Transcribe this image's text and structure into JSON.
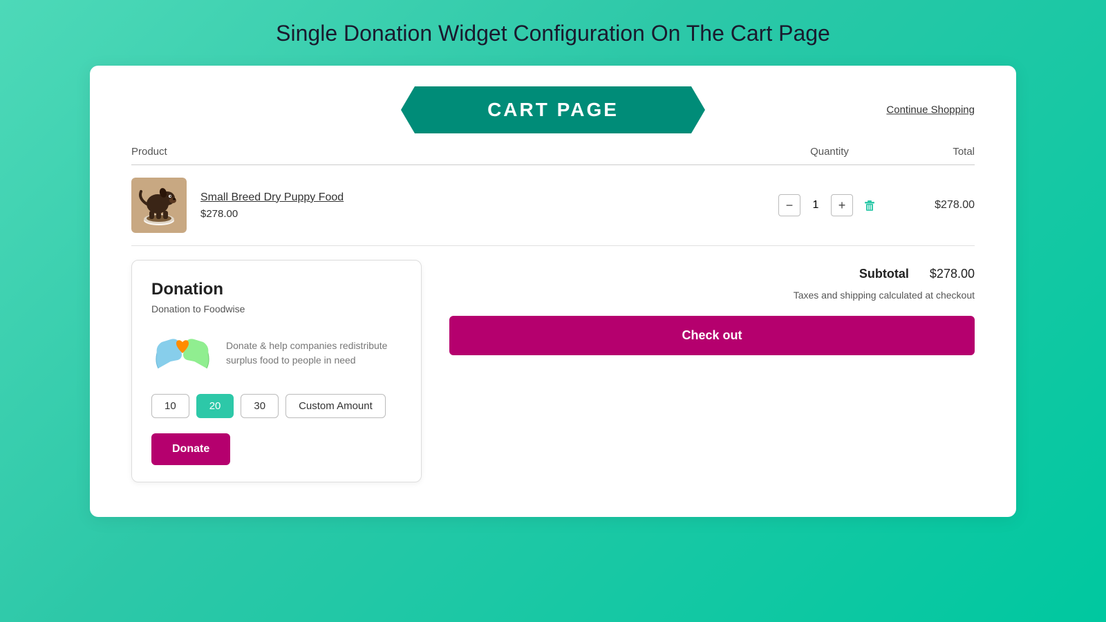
{
  "page": {
    "title": "Single Donation Widget Configuration On The Cart Page"
  },
  "header": {
    "banner_text": "CART PAGE",
    "continue_shopping": "Continue Shopping"
  },
  "table": {
    "headers": {
      "product": "Product",
      "quantity": "Quantity",
      "total": "Total"
    }
  },
  "product": {
    "name": "Small Breed Dry Puppy Food",
    "price": "$278.00",
    "quantity": 1,
    "total": "$278.00"
  },
  "donation": {
    "title": "Donation",
    "subtitle": "Donation to Foodwise",
    "description": "Donate & help companies redistribute surplus food to people in need",
    "amounts": [
      {
        "value": "10",
        "label": "10",
        "active": false
      },
      {
        "value": "20",
        "label": "20",
        "active": true
      },
      {
        "value": "30",
        "label": "30",
        "active": false
      }
    ],
    "custom_amount_label": "Custom Amount",
    "donate_button": "Donate"
  },
  "summary": {
    "subtotal_label": "Subtotal",
    "subtotal_value": "$278.00",
    "tax_note": "Taxes and shipping calculated at checkout",
    "checkout_button": "Check out"
  }
}
